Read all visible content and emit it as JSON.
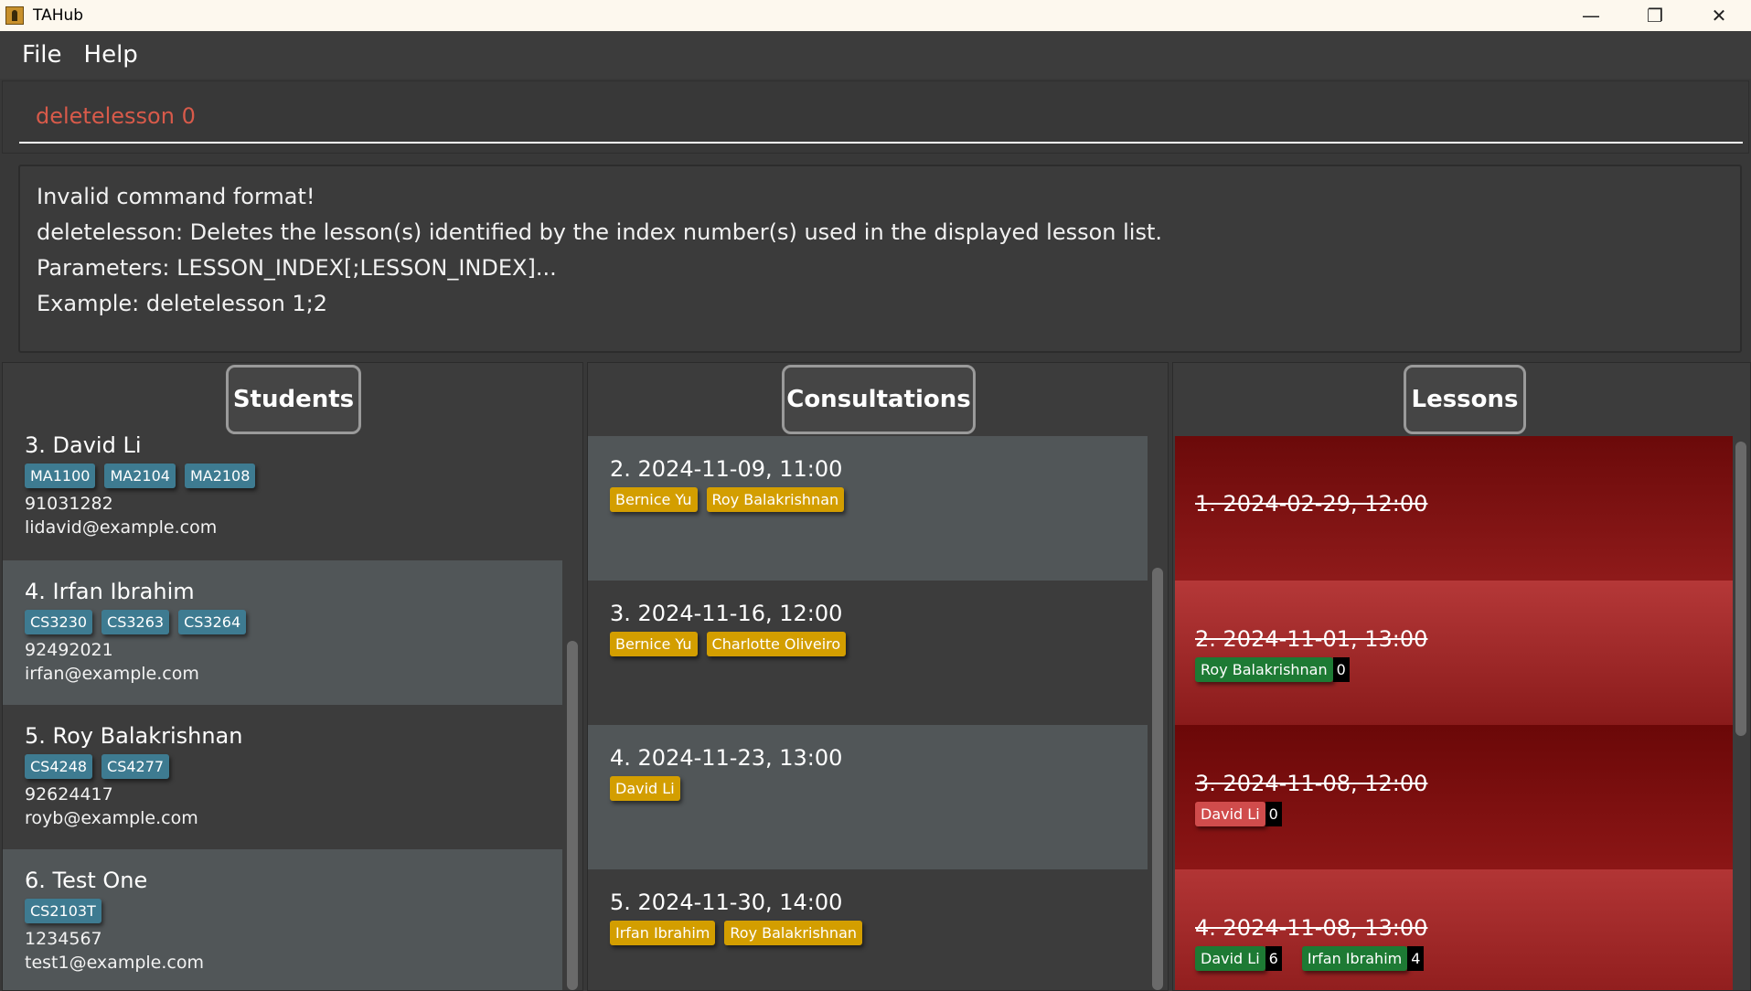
{
  "window": {
    "title": "TAHub",
    "controls": {
      "minimize": "—",
      "maximize": "❐",
      "close": "✕"
    }
  },
  "menu": {
    "file": "File",
    "help": "Help"
  },
  "command": {
    "value": "deletelesson 0"
  },
  "result": {
    "lines": [
      "Invalid command format!",
      "deletelesson: Deletes the lesson(s) identified by the index number(s) used in the displayed lesson list.",
      "Parameters: LESSON_INDEX[;LESSON_INDEX]...",
      "Example: deletelesson 1;2"
    ]
  },
  "panels": {
    "students": "Students",
    "consultations": "Consultations",
    "lessons": "Lessons"
  },
  "students": [
    {
      "title": "3. David Li",
      "tags": [
        "MA1100",
        "MA2104",
        "MA2108"
      ],
      "phone": "91031282",
      "email": "lidavid@example.com"
    },
    {
      "title": "4. Irfan Ibrahim",
      "tags": [
        "CS3230",
        "CS3263",
        "CS3264"
      ],
      "phone": "92492021",
      "email": "irfan@example.com"
    },
    {
      "title": "5. Roy Balakrishnan",
      "tags": [
        "CS4248",
        "CS4277"
      ],
      "phone": "92624417",
      "email": "royb@example.com"
    },
    {
      "title": "6. Test One",
      "tags": [
        "CS2103T"
      ],
      "phone": "1234567",
      "email": "test1@example.com"
    }
  ],
  "consultations": [
    {
      "title": "2. 2024-11-09, 11:00",
      "students": [
        "Bernice Yu",
        "Roy Balakrishnan"
      ]
    },
    {
      "title": "3. 2024-11-16, 12:00",
      "students": [
        "Bernice Yu",
        "Charlotte Oliveiro"
      ]
    },
    {
      "title": "4. 2024-11-23, 13:00",
      "students": [
        "David Li"
      ]
    },
    {
      "title": "5. 2024-11-30, 14:00",
      "students": [
        "Irfan Ibrahim",
        "Roy Balakrishnan"
      ]
    }
  ],
  "lessons": [
    {
      "title": "1. 2024-02-29, 12:00",
      "students": []
    },
    {
      "title": "2. 2024-11-01, 13:00",
      "students": [
        {
          "name": "Roy Balakrishnan",
          "count": "0",
          "color": "green"
        }
      ]
    },
    {
      "title": "3. 2024-11-08, 12:00",
      "students": [
        {
          "name": "David Li",
          "count": "0",
          "color": "red"
        }
      ]
    },
    {
      "title": "4. 2024-11-08, 13:00",
      "students": [
        {
          "name": "David Li",
          "count": "6",
          "color": "green"
        },
        {
          "name": "Irfan Ibrahim",
          "count": "4",
          "color": "green"
        }
      ]
    }
  ],
  "colors": {
    "module_tag": "#3e7b91",
    "student_tag": "#d39e00",
    "present_tag": "#1d7a34",
    "absent_tag": "#d04c4c",
    "error_text": "#d85a4a"
  }
}
